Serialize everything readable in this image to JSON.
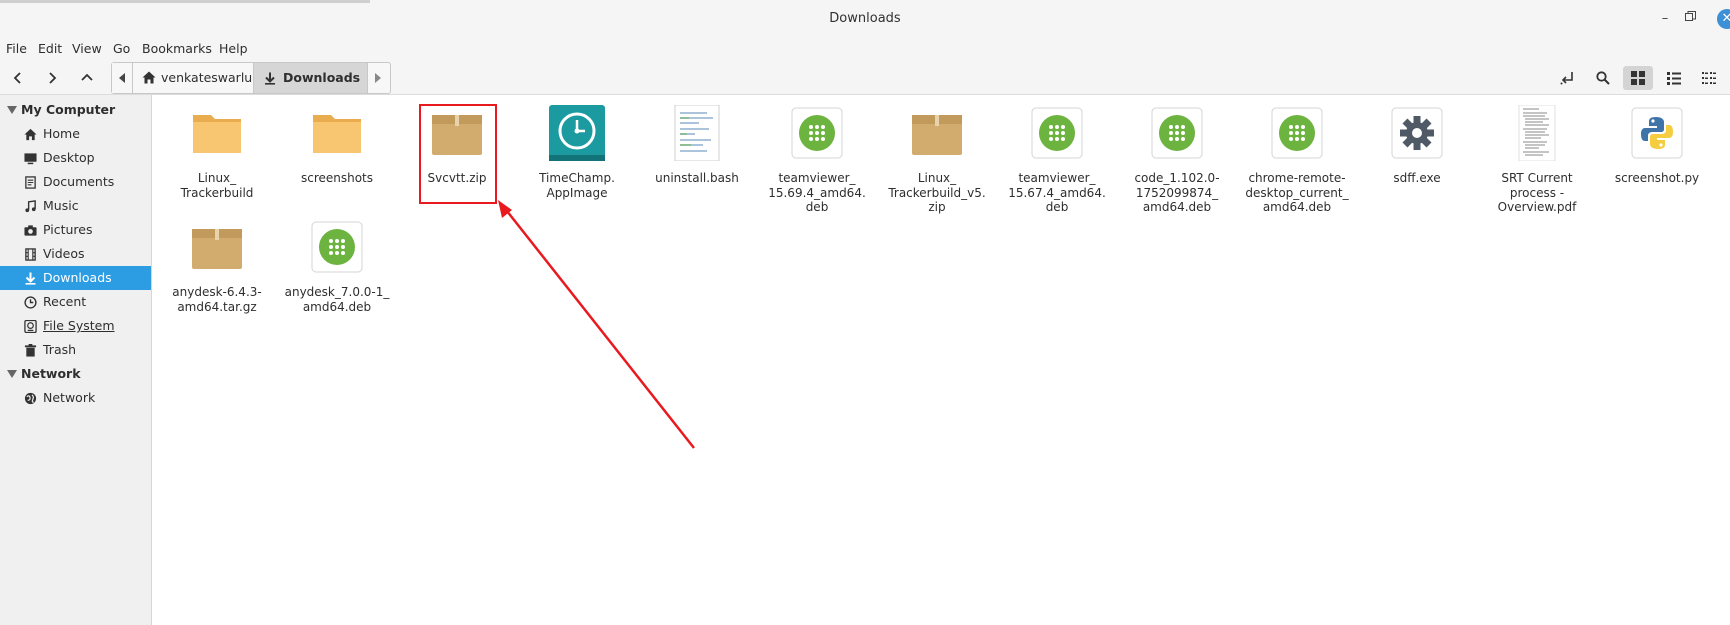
{
  "window": {
    "title": "Downloads"
  },
  "menu": [
    "File",
    "Edit",
    "View",
    "Go",
    "Bookmarks",
    "Help"
  ],
  "breadcrumb": {
    "home": "venkateswarlu",
    "current": "Downloads"
  },
  "sidebar": {
    "sections": [
      {
        "label": "My Computer",
        "items": [
          {
            "label": "Home",
            "icon": "home-icon"
          },
          {
            "label": "Desktop",
            "icon": "desktop-icon"
          },
          {
            "label": "Documents",
            "icon": "documents-icon"
          },
          {
            "label": "Music",
            "icon": "music-icon"
          },
          {
            "label": "Pictures",
            "icon": "camera-icon"
          },
          {
            "label": "Videos",
            "icon": "film-icon"
          },
          {
            "label": "Downloads",
            "icon": "download-icon",
            "active": true
          },
          {
            "label": "Recent",
            "icon": "clock-icon"
          },
          {
            "label": "File System",
            "icon": "drive-icon"
          },
          {
            "label": "Trash",
            "icon": "trash-icon"
          }
        ]
      },
      {
        "label": "Network",
        "items": [
          {
            "label": "Network",
            "icon": "network-icon"
          }
        ]
      }
    ]
  },
  "files": [
    {
      "name": "Linux_\nTrackerbuild",
      "type": "folder"
    },
    {
      "name": "screenshots",
      "type": "folder"
    },
    {
      "name": "Svcvtt.zip",
      "type": "archive",
      "highlighted": true
    },
    {
      "name": "TimeChamp.\nAppImage",
      "type": "appimage"
    },
    {
      "name": "uninstall.bash",
      "type": "text"
    },
    {
      "name": "teamviewer_\n15.69.4_amd64.\ndeb",
      "type": "deb"
    },
    {
      "name": "Linux_\nTrackerbuild_v5.\nzip",
      "type": "archive"
    },
    {
      "name": "teamviewer_\n15.67.4_amd64.\ndeb",
      "type": "deb"
    },
    {
      "name": "code_1.102.0-\n1752099874_\namd64.deb",
      "type": "deb"
    },
    {
      "name": "chrome-remote-\ndesktop_current_\namd64.deb",
      "type": "deb"
    },
    {
      "name": "sdff.exe",
      "type": "exe"
    },
    {
      "name": "SRT Current\nprocess -\nOverview.pdf",
      "type": "pdf"
    },
    {
      "name": "screenshot.py",
      "type": "python"
    },
    {
      "name": "anydesk-6.4.3-\namd64.tar.gz",
      "type": "archive"
    },
    {
      "name": "anydesk_7.0.0-1_\namd64.deb",
      "type": "deb"
    }
  ],
  "colors": {
    "accent": "#2c9de3",
    "annotation": "#e8191f",
    "folder": "#f5c46e",
    "deb": "#6cb33f",
    "appimage": "#1b9aa0"
  }
}
